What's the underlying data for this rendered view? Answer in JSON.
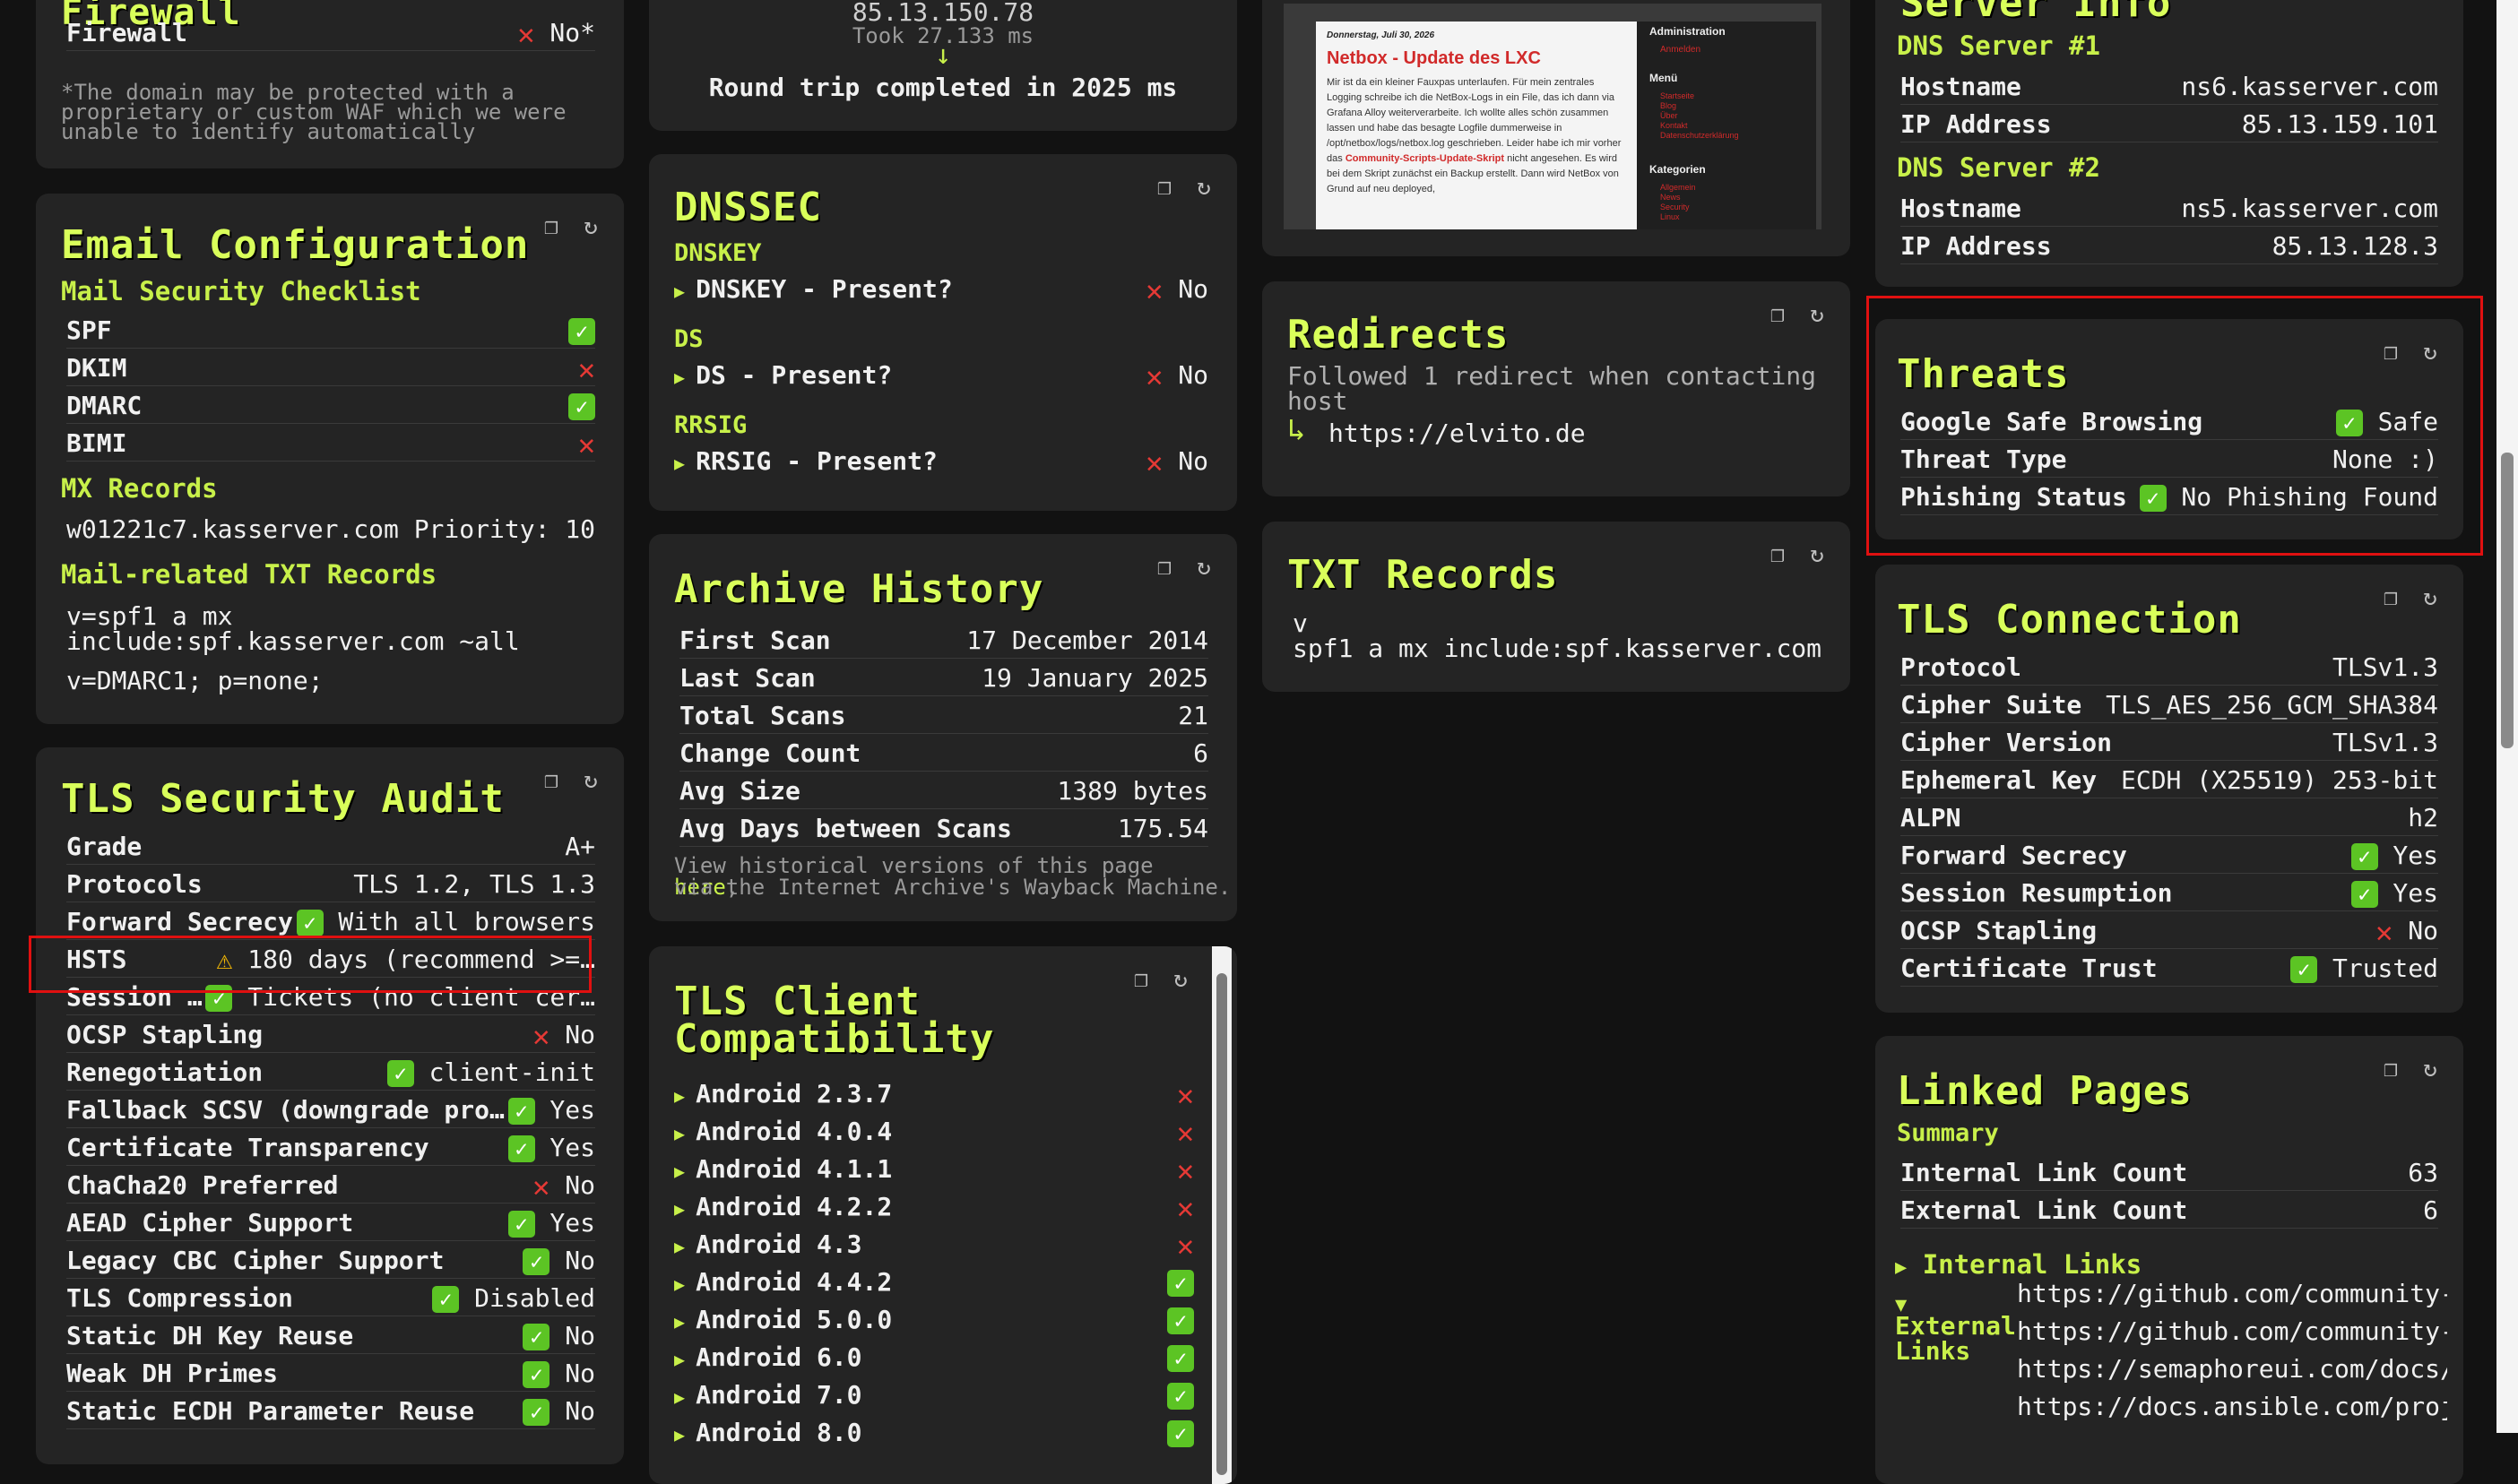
{
  "firewall": {
    "label": "Firewall",
    "value": "No*",
    "note": "*The domain may be protected with a proprietary or custom WAF which we were unable to identify automatically"
  },
  "email": {
    "title": "Email Configuration",
    "checklist_title": "Mail Security Checklist",
    "checks": [
      {
        "label": "SPF",
        "ok": true
      },
      {
        "label": "DKIM",
        "ok": false
      },
      {
        "label": "DMARC",
        "ok": true
      },
      {
        "label": "BIMI",
        "ok": false
      }
    ],
    "mx_title": "MX Records",
    "mx_host": "w01221c7.kasserver.com",
    "mx_priority": "Priority: 10",
    "txt_title": "Mail-related TXT Records",
    "txt_spf": "v=spf1 a mx include:spf.kasserver.com ~all",
    "txt_dmarc": "v=DMARC1; p=none;"
  },
  "tls_audit": {
    "title": "TLS Security Audit",
    "rows": [
      {
        "label": "Grade",
        "value": "A+",
        "icon": ""
      },
      {
        "label": "Protocols",
        "value": "TLS 1.2, TLS 1.3",
        "icon": ""
      },
      {
        "label": "Forward Secrecy",
        "value": "With all browsers",
        "icon": "check"
      },
      {
        "label": "HSTS",
        "value": "180 days (recommend >=…",
        "icon": "warn"
      },
      {
        "label": "Session …",
        "value": "Tickets (no client cer…",
        "icon": "check"
      },
      {
        "label": "OCSP Stapling",
        "value": "No",
        "icon": "x"
      },
      {
        "label": "Renegotiation",
        "value": "client-init",
        "icon": "check"
      },
      {
        "label": "Fallback SCSV (downgrade pro…",
        "value": "Yes",
        "icon": "check"
      },
      {
        "label": "Certificate Transparency",
        "value": "Yes",
        "icon": "check"
      },
      {
        "label": "ChaCha20 Preferred",
        "value": "No",
        "icon": "x"
      },
      {
        "label": "AEAD Cipher Support",
        "value": "Yes",
        "icon": "check"
      },
      {
        "label": "Legacy CBC Cipher Support",
        "value": "No",
        "icon": "check"
      },
      {
        "label": "TLS Compression",
        "value": "Disabled",
        "icon": "check"
      },
      {
        "label": "Static DH Key Reuse",
        "value": "No",
        "icon": "check"
      },
      {
        "label": "Weak DH Primes",
        "value": "No",
        "icon": "check"
      },
      {
        "label": "Static ECDH Parameter Reuse",
        "value": "No",
        "icon": "check"
      }
    ]
  },
  "trace": {
    "ip": "85.13.150.78",
    "took": "Took 27.133 ms",
    "summary": "Round trip completed in 2025 ms"
  },
  "dnssec": {
    "title": "DNSSEC",
    "sections": [
      {
        "heading": "DNSKEY",
        "label": "DNSKEY - Present?",
        "value": "No"
      },
      {
        "heading": "DS",
        "label": "DS - Present?",
        "value": "No"
      },
      {
        "heading": "RRSIG",
        "label": "RRSIG - Present?",
        "value": "No"
      }
    ]
  },
  "archive": {
    "title": "Archive History",
    "rows": [
      {
        "label": "First Scan",
        "value": "17 December 2014"
      },
      {
        "label": "Last Scan",
        "value": "19 January 2025"
      },
      {
        "label": "Total Scans",
        "value": "21"
      },
      {
        "label": "Change Count",
        "value": "6"
      },
      {
        "label": "Avg Size",
        "value": "1389 bytes"
      },
      {
        "label": "Avg Days between Scans",
        "value": "175.54"
      }
    ],
    "note_prefix": "View historical versions of this page ",
    "note_link": "here",
    "note_suffix": ",",
    "note_line2": "via the Internet Archive's Wayback Machine."
  },
  "client_compat": {
    "title_line1": "TLS Client",
    "title_line2": "Compatibility",
    "clients": [
      {
        "name": "Android 2.3.7",
        "ok": false
      },
      {
        "name": "Android 4.0.4",
        "ok": false
      },
      {
        "name": "Android 4.1.1",
        "ok": false
      },
      {
        "name": "Android 4.2.2",
        "ok": false
      },
      {
        "name": "Android 4.3",
        "ok": false
      },
      {
        "name": "Android 4.4.2",
        "ok": true
      },
      {
        "name": "Android 5.0.0",
        "ok": true
      },
      {
        "name": "Android 6.0",
        "ok": true
      },
      {
        "name": "Android 7.0",
        "ok": true
      },
      {
        "name": "Android 8.0",
        "ok": true
      }
    ]
  },
  "screenshot": {
    "date": "Donnerstag, Juli 30, 2026",
    "post_title": "Netbox - Update des LXC",
    "body": "Mir ist da ein kleiner Fauxpas unterlaufen. Für mein zentrales Logging schreibe ich die NetBox-Logs in ein File, das ich dann via Grafana Alloy weiterverarbeite. Ich wollte alles schön zusammen lassen und habe das besagte Logfile dummerweise in /opt/netbox/logs/netbox.log geschrieben. Leider habe ich mir vorher das",
    "link": "Community-Scripts-Update-Skript",
    "body2": "nicht angesehen. Es wird bei dem Skript zunächst ein Backup erstellt. Dann wird NetBox von Grund auf neu deployed,",
    "side_admin": "Administration",
    "side_login": "Anmelden",
    "side_menu": "Menü",
    "side_menu_items": [
      "Startseite",
      "Blog",
      "Über",
      "Kontakt",
      "Datenschutzerklärung"
    ],
    "side_categories": "Kategorien",
    "side_cat_items": [
      "Allgemein",
      "News",
      "Security",
      "Linux"
    ]
  },
  "redirects": {
    "title": "Redirects",
    "note": "Followed 1 redirect when contacting host",
    "target": "https://elvito.de"
  },
  "txt": {
    "title": "TXT Records",
    "key": "v",
    "value": "spf1 a mx include:spf.kasserver.com…"
  },
  "server_info": {
    "title": "Server Info",
    "dns1_title": "DNS Server #1",
    "dns1": [
      {
        "label": "Hostname",
        "value": "ns6.kasserver.com"
      },
      {
        "label": "IP Address",
        "value": "85.13.159.101"
      }
    ],
    "dns2_title": "DNS Server #2",
    "dns2": [
      {
        "label": "Hostname",
        "value": "ns5.kasserver.com"
      },
      {
        "label": "IP Address",
        "value": "85.13.128.3"
      }
    ]
  },
  "threats": {
    "title": "Threats",
    "rows": [
      {
        "label": "Google Safe Browsing",
        "value": "Safe",
        "icon": "check"
      },
      {
        "label": "Threat Type",
        "value": "None :)",
        "icon": ""
      },
      {
        "label": "Phishing Status",
        "value": "No Phishing Found",
        "icon": "check"
      }
    ]
  },
  "tls_conn": {
    "title": "TLS Connection",
    "rows": [
      {
        "label": "Protocol",
        "value": "TLSv1.3",
        "icon": ""
      },
      {
        "label": "Cipher Suite",
        "value": "TLS_AES_256_GCM_SHA384",
        "icon": ""
      },
      {
        "label": "Cipher Version",
        "value": "TLSv1.3",
        "icon": ""
      },
      {
        "label": "Ephemeral Key",
        "value": "ECDH (X25519) 253-bit",
        "icon": ""
      },
      {
        "label": "ALPN",
        "value": "h2",
        "icon": ""
      },
      {
        "label": "Forward Secrecy",
        "value": "Yes",
        "icon": "check"
      },
      {
        "label": "Session Resumption",
        "value": "Yes",
        "icon": "check"
      },
      {
        "label": "OCSP Stapling",
        "value": "No",
        "icon": "x"
      },
      {
        "label": "Certificate Trust",
        "value": "Trusted",
        "icon": "check"
      }
    ]
  },
  "linked": {
    "title": "Linked Pages",
    "summary_title": "Summary",
    "rows": [
      {
        "label": "Internal Link Count",
        "value": "63"
      },
      {
        "label": "External Link Count",
        "value": "6"
      }
    ],
    "internal_label": "Internal Links",
    "external_label_1": "External",
    "external_label_2": "Links",
    "links": [
      "https://github.com/community-s",
      "https://github.com/community-s",
      "https://semaphoreui.com/docs/a",
      "https://docs.ansible.com/proje"
    ]
  },
  "icons": {
    "copy": "copy-icon",
    "refresh": "refresh-icon",
    "check": "check-icon",
    "cross": "cross-icon",
    "warning": "warning-icon",
    "expand": "triangle-right-icon"
  },
  "colors": {
    "accent": "#d9ff5a",
    "ok": "#5cc424",
    "bad": "#e53935",
    "card": "#242424",
    "page": "#121212"
  }
}
